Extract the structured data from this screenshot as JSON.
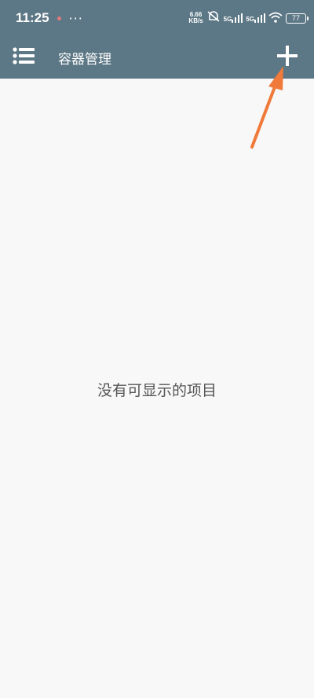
{
  "status_bar": {
    "time": "11:25",
    "more": "···",
    "net_speed_value": "6.66",
    "net_speed_unit": "KB/s",
    "sim1": "5G",
    "sim2": "5G",
    "battery": "77"
  },
  "app_bar": {
    "title": "容器管理",
    "menu_icon": "menu-list-icon",
    "add_icon": "plus-icon"
  },
  "content": {
    "empty_message": "没有可显示的项目"
  },
  "colors": {
    "toolbar": "#5c7785",
    "background": "#f8f8f8",
    "annotation_arrow": "#f07a3a"
  }
}
